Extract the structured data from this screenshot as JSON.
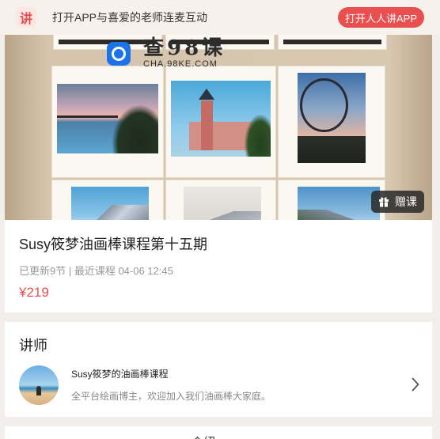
{
  "banner": {
    "logo_char": "讲",
    "text": "打开APP与喜爱的老师连麦互动",
    "button_label": "打开人人讲APP"
  },
  "hero": {
    "watermark_title": "查98课",
    "watermark_url": "CHA.98KE.COM",
    "gift_label": "赠课"
  },
  "course": {
    "title": "Susy筱梦油画棒课程第十五期",
    "meta": "已更新9节 | 最近课程 04-06 12:45",
    "price": "¥219"
  },
  "lecturer": {
    "heading": "讲师",
    "name": "Susy筱梦的油画棒课程",
    "description": "全平台绘画博主，欢迎加入我们油画棒大家庭。"
  },
  "next_section": {
    "label": "介绍"
  },
  "colors": {
    "accent": "#ea4f4f",
    "banner_bg": "#f7f1ec"
  }
}
